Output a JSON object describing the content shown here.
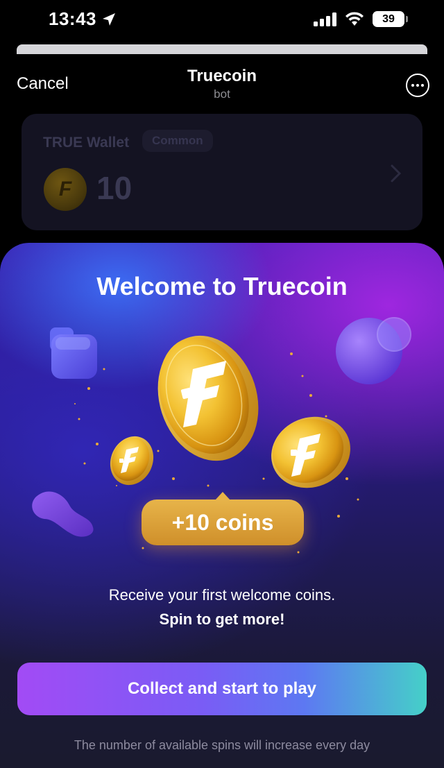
{
  "status_bar": {
    "time": "13:43",
    "battery": "39",
    "icons": [
      "location-arrow-icon",
      "signal-icon",
      "wifi-icon",
      "battery-icon"
    ]
  },
  "header": {
    "cancel_label": "Cancel",
    "title": "Truecoin",
    "subtitle": "bot",
    "more_icon": "more-dots-icon"
  },
  "wallet_card": {
    "title": "TRUE Wallet",
    "badge": "Common",
    "coin_glyph": "F",
    "amount": "10",
    "chevron_icon": "chevron-right-icon"
  },
  "modal": {
    "title": "Welcome to Truecoin",
    "reward": "+10 coins",
    "description_line1": "Receive your first welcome coins.",
    "description_line2": "Spin to get more!",
    "cta_label": "Collect and start to play",
    "footnote": "The number of available spins will increase every day"
  },
  "colors": {
    "modal_top": "#3b1fb0",
    "modal_bottom": "#1a1a2e",
    "gold": "#e7b44a",
    "cta_start": "#a24bf5",
    "cta_end": "#45d0c8"
  }
}
